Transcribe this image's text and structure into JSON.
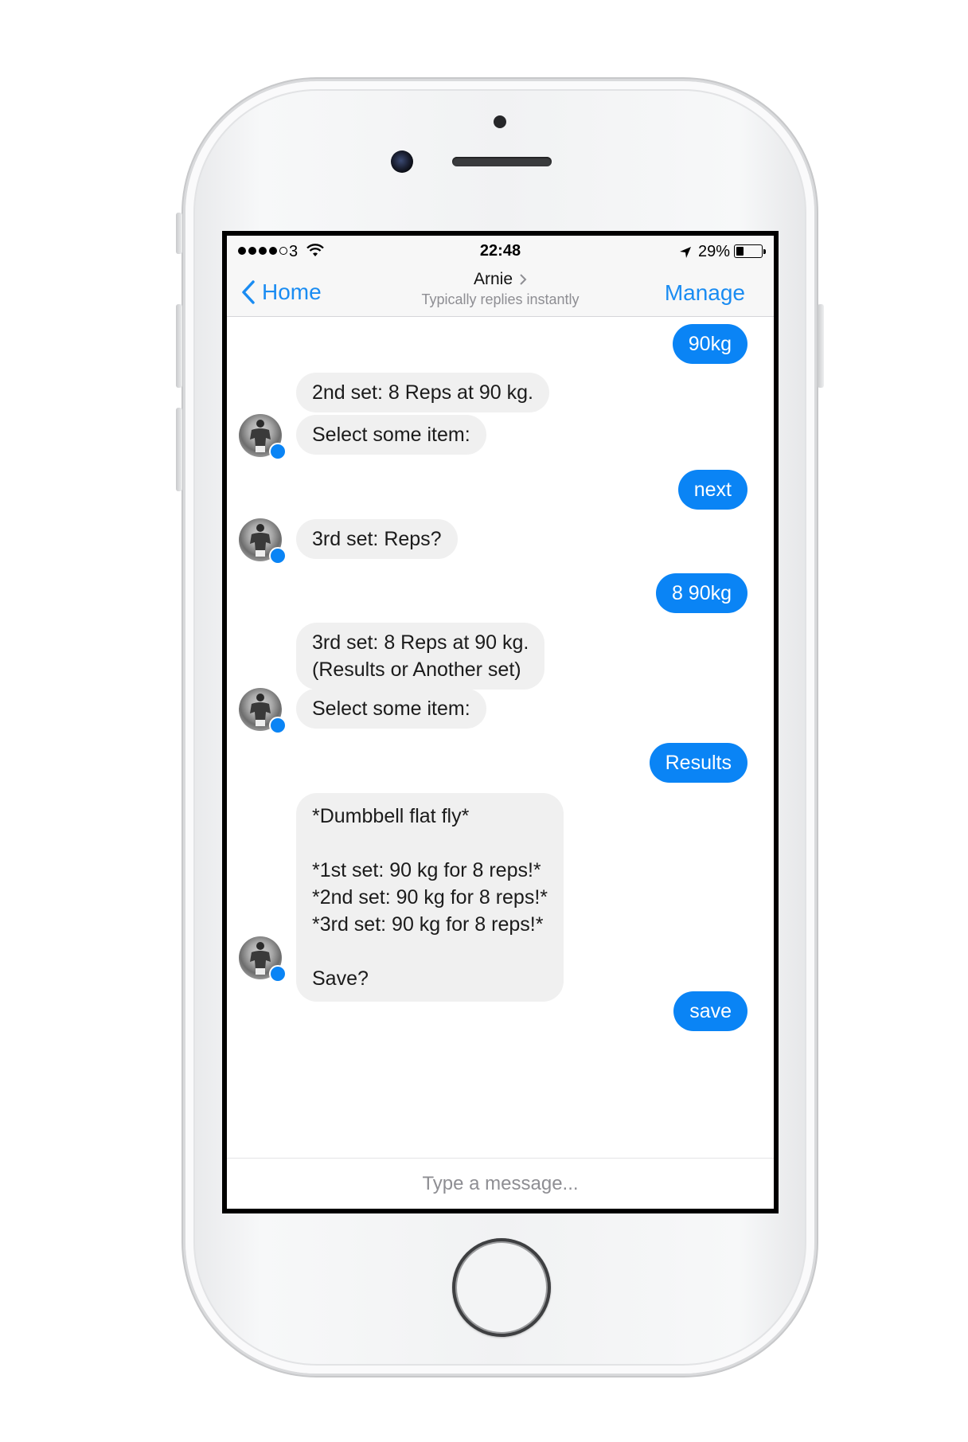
{
  "status_bar": {
    "carrier": "3",
    "time": "22:48",
    "battery_percent": "29%",
    "battery_level": 0.29,
    "signal_bars_filled": 4,
    "signal_bars_total": 5
  },
  "nav": {
    "back_label": "Home",
    "contact_name": "Arnie",
    "contact_subtitle": "Typically replies instantly",
    "manage_label": "Manage"
  },
  "messages": [
    {
      "direction": "out",
      "text": "90kg"
    },
    {
      "direction": "in",
      "text": "2nd set: 8 Reps at 90 kg."
    },
    {
      "direction": "in",
      "text": "Select some item:"
    },
    {
      "direction": "out",
      "text": "next"
    },
    {
      "direction": "in",
      "text": "3rd set: Reps?"
    },
    {
      "direction": "out",
      "text": "8 90kg"
    },
    {
      "direction": "in",
      "text": "3rd set: 8 Reps at 90 kg.\n(Results or Another set)"
    },
    {
      "direction": "in",
      "text": "Select some item:"
    },
    {
      "direction": "out",
      "text": "Results"
    },
    {
      "direction": "in",
      "text": "*Dumbbell flat fly*\n\n*1st set: 90 kg for 8 reps!*\n*2nd set: 90 kg for 8 reps!*\n*3rd set: 90 kg for 8 reps!*\n\nSave?"
    },
    {
      "direction": "out",
      "text": "save"
    }
  ],
  "composer": {
    "placeholder": "Type a message..."
  },
  "colors": {
    "accent": "#0a84f5",
    "incoming_bubble": "#f0f0f0",
    "nav_background": "#f7f7f7"
  }
}
